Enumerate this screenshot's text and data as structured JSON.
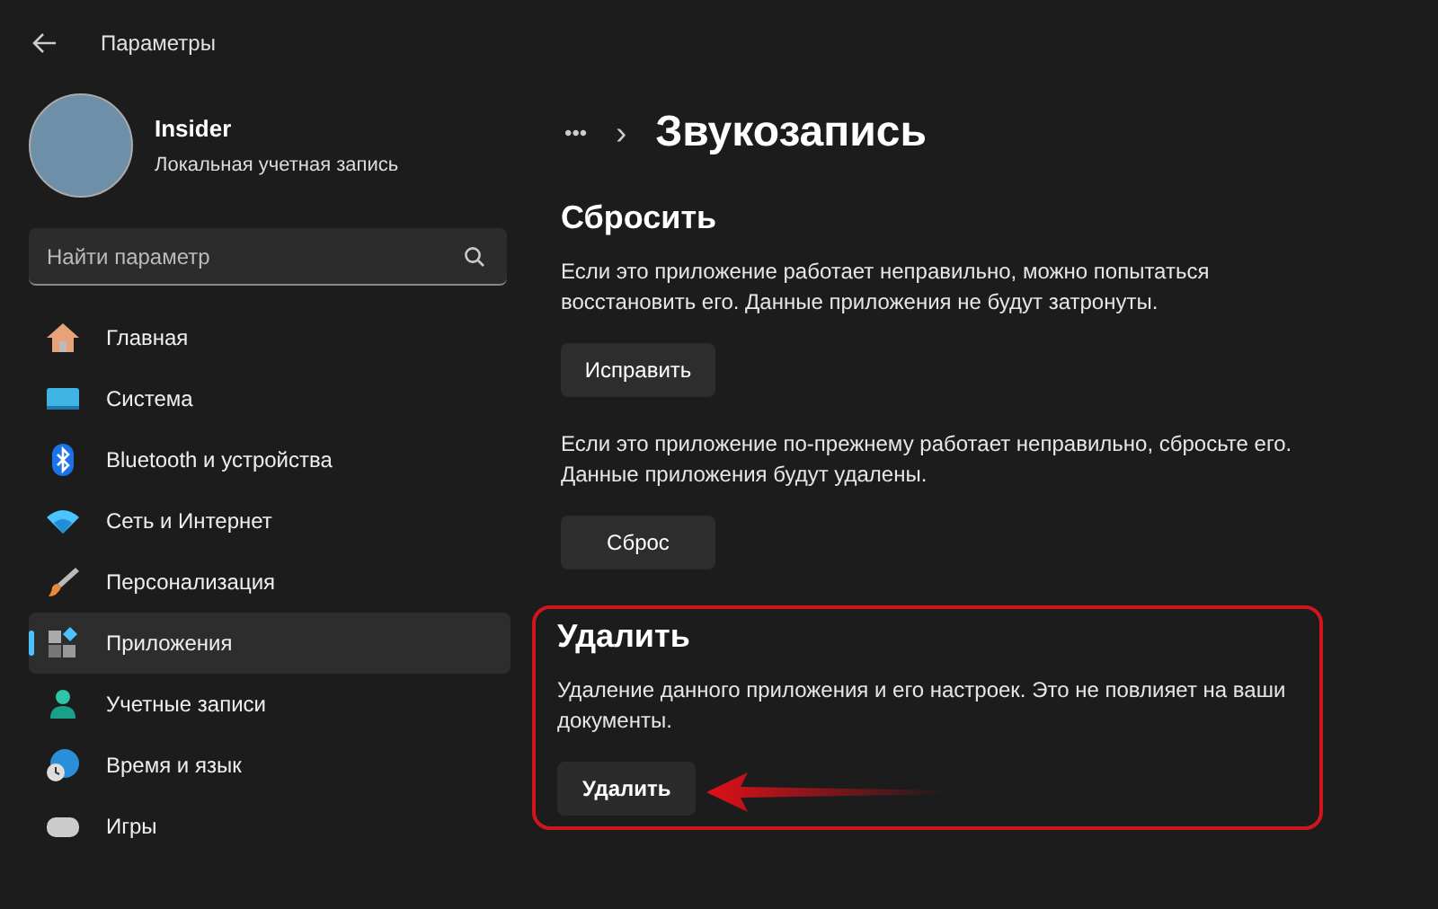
{
  "window": {
    "title": "Параметры"
  },
  "profile": {
    "name": "Insider",
    "account": "Локальная учетная запись"
  },
  "search": {
    "placeholder": "Найти параметр"
  },
  "sidebar": {
    "items": [
      {
        "label": "Главная",
        "kind": "home",
        "selected": false
      },
      {
        "label": "Система",
        "kind": "system",
        "selected": false
      },
      {
        "label": "Bluetooth и устройства",
        "kind": "bluetooth",
        "selected": false
      },
      {
        "label": "Сеть и Интернет",
        "kind": "network",
        "selected": false
      },
      {
        "label": "Персонализация",
        "kind": "personalization",
        "selected": false
      },
      {
        "label": "Приложения",
        "kind": "apps",
        "selected": true
      },
      {
        "label": "Учетные записи",
        "kind": "accounts",
        "selected": false
      },
      {
        "label": "Время и язык",
        "kind": "time",
        "selected": false
      },
      {
        "label": "Игры",
        "kind": "gaming",
        "selected": false
      }
    ]
  },
  "breadcrumb": {
    "more": "•••",
    "separator": "›",
    "title": "Звукозапись"
  },
  "sections": [
    {
      "heading": "Сбросить",
      "highlighted": false,
      "blocks": [
        {
          "text": "Если это приложение работает неправильно, можно попытаться восстановить его. Данные приложения не будут затронуты.",
          "button": "Исправить"
        },
        {
          "text": "Если это приложение по-прежнему работает неправильно, сбросьте его. Данные приложения будут удалены.",
          "button": "Сброс"
        }
      ]
    },
    {
      "heading": "Удалить",
      "highlighted": true,
      "blocks": [
        {
          "text": "Удаление данного приложения и его настроек. Это не повлияет на ваши документы.",
          "button": "Удалить"
        }
      ]
    }
  ]
}
